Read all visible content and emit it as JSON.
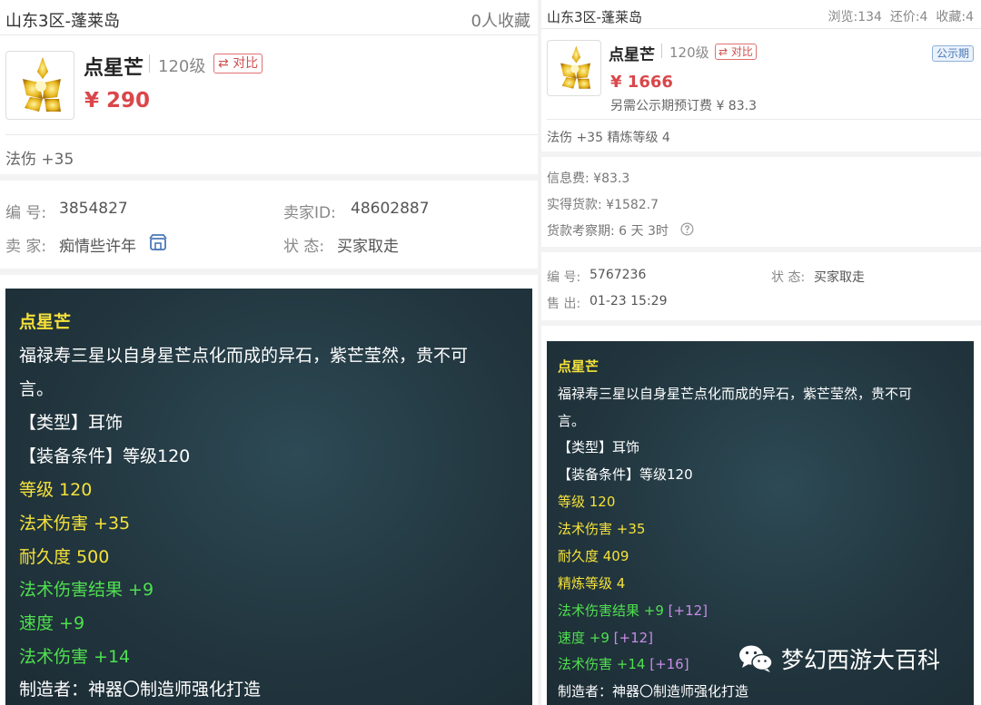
{
  "left": {
    "server": "山东3区-蓬莱岛",
    "favorites": "0人收藏",
    "item_name": "点星芒",
    "level_label": "120级",
    "compare_label": "对比",
    "price": "¥ 290",
    "attr_line": "法伤 +35",
    "info": {
      "number_label": "编 号:",
      "number_value": "3854827",
      "seller_id_label": "卖家ID:",
      "seller_id_value": "48602887",
      "seller_label": "卖 家:",
      "seller_value": "痴情些许年",
      "status_label": "状 态:",
      "status_value": "买家取走"
    },
    "tooltip": {
      "title": "点星芒",
      "desc1": "福禄寿三星以自身星芒点化而成的异石，紫芒莹然，贵不可",
      "desc2": "言。",
      "type": "【类型】耳饰",
      "req": "【装备条件】等级120",
      "level": "等级 120",
      "magic_dmg": "法术伤害 +35",
      "durability": "耐久度 500",
      "gem1": "法术伤害结果 +9",
      "gem2": "速度 +9",
      "gem3": "法术伤害 +14",
      "maker": "制造者：神器〇制造师强化打造"
    }
  },
  "right": {
    "server": "山东3区-蓬莱岛",
    "stats": "浏览:134  还价:4  收藏:4",
    "item_name": "点星芒",
    "level_label": "120级",
    "compare_label": "对比",
    "badge": "公示期",
    "price": "¥ 1666",
    "preorder": "另需公示期预订费 ¥ 83.3",
    "attr_line": "法伤 +35 精炼等级 4",
    "fees": {
      "info_fee": "信息费: ¥83.3",
      "actual": "实得货款: ¥1582.7",
      "review": "货款考察期: 6 天 3时"
    },
    "info": {
      "number_label": "编 号:",
      "number_value": "5767236",
      "status_label": "状 态:",
      "status_value": "买家取走",
      "sold_label": "售 出:",
      "sold_value": "01-23 15:29"
    },
    "tooltip": {
      "title": "点星芒",
      "desc1": "福禄寿三星以自身星芒点化而成的异石，紫芒莹然，贵不可",
      "desc2": "言。",
      "type": "【类型】耳饰",
      "req": "【装备条件】等级120",
      "level": "等级 120",
      "magic_dmg": "法术伤害 +35",
      "durability": "耐久度 409",
      "refine": "精炼等级 4",
      "gem1": "法术伤害结果 +9",
      "gem1_plus": "[+12]",
      "gem2": "速度 +9",
      "gem2_plus": "[+12]",
      "gem3": "法术伤害 +14",
      "gem3_plus": "[+16]",
      "maker": "制造者：神器〇制造师强化打造"
    }
  },
  "watermark": "梦幻西游大百科",
  "colors": {
    "price": "#d9474a",
    "tooltip_bg": "#22363f",
    "yellow_text": "#f5e23a",
    "green_text": "#4fe04f",
    "purple_text": "#c98be6"
  }
}
